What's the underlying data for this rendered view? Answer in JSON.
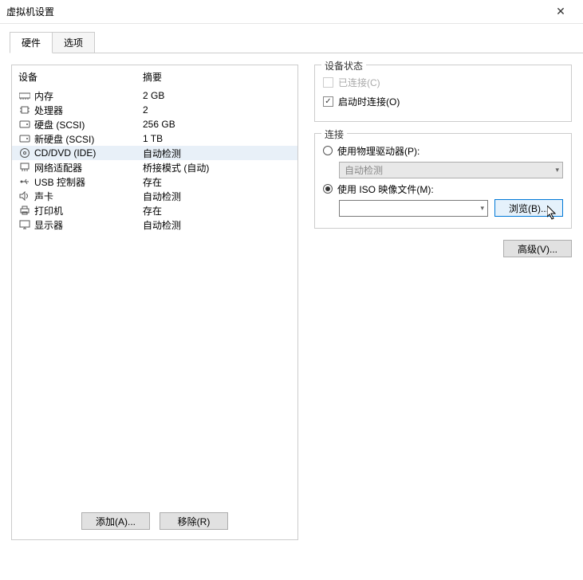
{
  "window": {
    "title": "虚拟机设置"
  },
  "tabs": {
    "hardware": "硬件",
    "options": "选项",
    "active": "hardware"
  },
  "columns": {
    "device": "设备",
    "summary": "摘要"
  },
  "devices": [
    {
      "id": "memory",
      "name": "内存",
      "summary": "2 GB"
    },
    {
      "id": "cpu",
      "name": "处理器",
      "summary": "2"
    },
    {
      "id": "disk1",
      "name": "硬盘 (SCSI)",
      "summary": "256 GB"
    },
    {
      "id": "disk2",
      "name": "新硬盘 (SCSI)",
      "summary": "1 TB"
    },
    {
      "id": "cdrom",
      "name": "CD/DVD (IDE)",
      "summary": "自动检测",
      "selected": true
    },
    {
      "id": "nic",
      "name": "网络适配器",
      "summary": "桥接模式 (自动)"
    },
    {
      "id": "usb",
      "name": "USB 控制器",
      "summary": "存在"
    },
    {
      "id": "sound",
      "name": "声卡",
      "summary": "自动检测"
    },
    {
      "id": "printer",
      "name": "打印机",
      "summary": "存在"
    },
    {
      "id": "display",
      "name": "显示器",
      "summary": "自动检测"
    }
  ],
  "left_buttons": {
    "add": "添加(A)...",
    "remove": "移除(R)"
  },
  "detail": {
    "status_title": "设备状态",
    "connected": "已连接(C)",
    "connect_at_power": "启动时连接(O)",
    "connection_title": "连接",
    "use_physical": "使用物理驱动器(P):",
    "auto_detect": "自动检测",
    "use_iso": "使用 ISO 映像文件(M):",
    "browse": "浏览(B)...",
    "advanced": "高级(V)..."
  }
}
